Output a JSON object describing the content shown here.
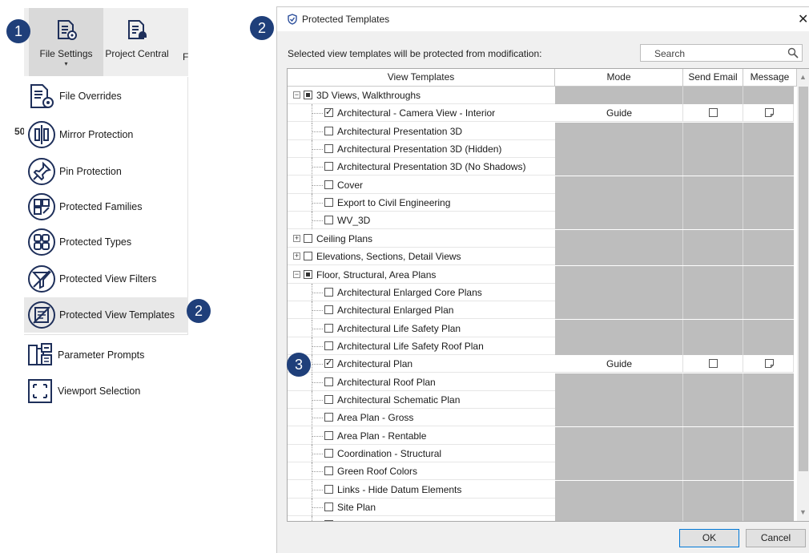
{
  "ribbon": {
    "file_settings_label": "File Settings",
    "file_settings_caret": "▾",
    "project_central_label": "Project Central",
    "cut_label": "F"
  },
  "side_number": "50",
  "menu": {
    "items": [
      {
        "label": "File Overrides",
        "icon": "file-overrides-icon"
      },
      {
        "label": "Mirror Protection",
        "icon": "mirror-protection-icon"
      },
      {
        "label": "Pin Protection",
        "icon": "pin-icon"
      },
      {
        "label": "Protected Families",
        "icon": "protected-families-icon"
      },
      {
        "label": "Protected Types",
        "icon": "protected-types-icon"
      },
      {
        "label": "Protected View Filters",
        "icon": "view-filter-icon"
      },
      {
        "label": "Protected View Templates",
        "icon": "view-templates-icon"
      }
    ],
    "extra": [
      {
        "label": "Parameter Prompts",
        "icon": "parameter-prompts-icon"
      },
      {
        "label": "Viewport Selection",
        "icon": "viewport-selection-icon"
      }
    ]
  },
  "badges": {
    "b1": "1",
    "b2_menu": "2",
    "b2_dialog": "2",
    "b3": "3"
  },
  "dialog": {
    "title": "Protected Templates",
    "close": "✕",
    "instruction": "Selected view templates will be protected from modification:",
    "search_placeholder": "Search",
    "columns": {
      "name": "View Templates",
      "mode": "Mode",
      "email": "Send Email",
      "message": "Message"
    },
    "ok": "OK",
    "cancel": "Cancel"
  },
  "rows": [
    {
      "label": "3D Views, Walkthroughs",
      "level": 0,
      "expander": "⊟",
      "state": "partial"
    },
    {
      "label": "Architectural - Camera View - Interior",
      "level": 1,
      "state": "checked",
      "mode": "Guide"
    },
    {
      "label": "Architectural Presentation 3D",
      "level": 1,
      "state": "unchecked"
    },
    {
      "label": "Architectural Presentation 3D (Hidden)",
      "level": 1,
      "state": "unchecked"
    },
    {
      "label": "Architectural Presentation 3D (No Shadows)",
      "level": 1,
      "state": "unchecked"
    },
    {
      "label": "Cover",
      "level": 1,
      "state": "unchecked"
    },
    {
      "label": "Export to Civil Engineering",
      "level": 1,
      "state": "unchecked"
    },
    {
      "label": "WV_3D",
      "level": 1,
      "state": "unchecked"
    },
    {
      "label": "Ceiling Plans",
      "level": 0,
      "expander": "⊞",
      "state": "unchecked"
    },
    {
      "label": "Elevations, Sections, Detail Views",
      "level": 0,
      "expander": "⊞",
      "state": "unchecked"
    },
    {
      "label": "Floor, Structural, Area Plans",
      "level": 0,
      "expander": "⊟",
      "state": "partial"
    },
    {
      "label": "Architectural Enlarged Core Plans",
      "level": 1,
      "state": "unchecked"
    },
    {
      "label": "Architectural Enlarged Plan",
      "level": 1,
      "state": "unchecked"
    },
    {
      "label": "Architectural Life Safety Plan",
      "level": 1,
      "state": "unchecked"
    },
    {
      "label": "Architectural Life Safety Roof Plan",
      "level": 1,
      "state": "unchecked"
    },
    {
      "label": "Architectural Plan",
      "level": 1,
      "state": "checked",
      "mode": "Guide"
    },
    {
      "label": "Architectural Roof Plan",
      "level": 1,
      "state": "unchecked"
    },
    {
      "label": "Architectural Schematic Plan",
      "level": 1,
      "state": "unchecked"
    },
    {
      "label": "Area Plan - Gross",
      "level": 1,
      "state": "unchecked"
    },
    {
      "label": "Area Plan - Rentable",
      "level": 1,
      "state": "unchecked"
    },
    {
      "label": "Coordination - Structural",
      "level": 1,
      "state": "unchecked"
    },
    {
      "label": "Green Roof Colors",
      "level": 1,
      "state": "unchecked"
    },
    {
      "label": "Links - Hide Datum Elements",
      "level": 1,
      "state": "unchecked"
    },
    {
      "label": "Site Plan",
      "level": 1,
      "state": "unchecked"
    },
    {
      "label": "",
      "level": 1,
      "state": "unchecked"
    }
  ],
  "colors": {
    "badge": "#1f3f7a",
    "icon_stroke": "#1e2f5a",
    "disabled_cell": "#bdbdbd",
    "accent": "#0078d7"
  }
}
